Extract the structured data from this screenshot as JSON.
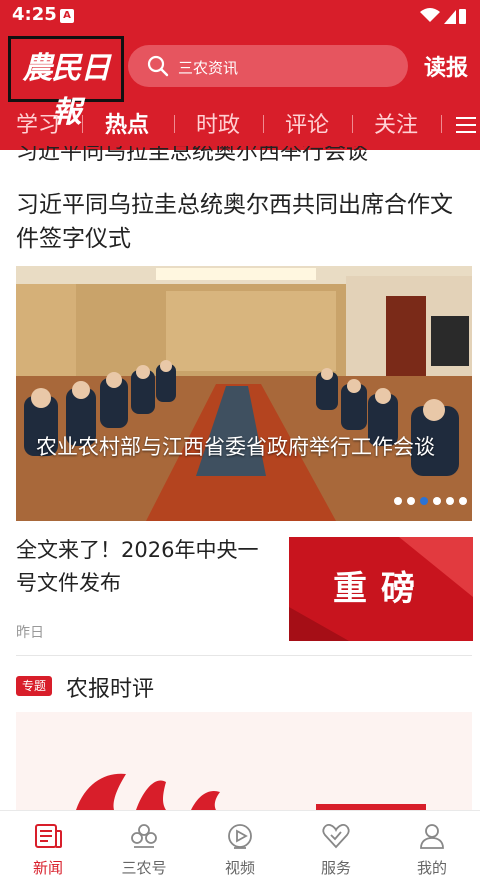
{
  "status_bar": {
    "time": "4:25",
    "notification_letter": "A"
  },
  "header": {
    "logo_text": "農民日報",
    "search": {
      "placeholder": "三农资讯"
    },
    "read_button": "读报",
    "tabs": [
      {
        "label": "学习",
        "active": false
      },
      {
        "label": "热点",
        "active": true
      },
      {
        "label": "时政",
        "active": false
      },
      {
        "label": "评论",
        "active": false
      },
      {
        "label": "关注",
        "active": false
      }
    ],
    "menu_icon": "menu-icon"
  },
  "feed": {
    "partial_headline": "习近平同乌拉圭总统奥尔西举行会谈",
    "headline": "习近平同乌拉圭总统奥尔西共同出席合作文件签字仪式",
    "banner": {
      "caption": "农业农村部与江西省委省政府举行工作会谈",
      "slide_count": 6,
      "active_slide": 2
    },
    "news2": {
      "title": "全文来了！2026年中央一号文件发布",
      "time": "昨日",
      "thumb_text": "重磅"
    },
    "topic": {
      "badge": "专题",
      "title": "农报时评"
    }
  },
  "bottom_nav": [
    {
      "label": "新闻",
      "icon": "news-icon",
      "active": true
    },
    {
      "label": "三农号",
      "icon": "sannong-icon",
      "active": false
    },
    {
      "label": "视频",
      "icon": "video-icon",
      "active": false
    },
    {
      "label": "服务",
      "icon": "service-icon",
      "active": false
    },
    {
      "label": "我的",
      "icon": "profile-icon",
      "active": false
    }
  ],
  "colors": {
    "brand_red": "#d81e2a",
    "active_dot": "#2a73d6"
  }
}
